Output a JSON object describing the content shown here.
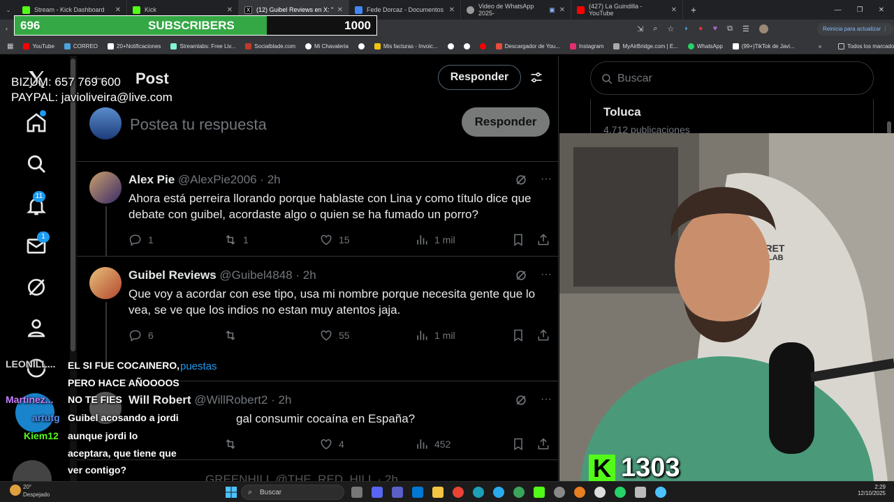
{
  "browser": {
    "tabs": [
      {
        "title": "Stream - Kick Dashboard",
        "color": "#53fc18"
      },
      {
        "title": "Kick",
        "color": "#53fc18"
      },
      {
        "title": "(12) Guibel Reviews en X: \"No e",
        "color": "#000000",
        "active": true
      },
      {
        "title": "Fede Dorcaz - Documentos de",
        "color": "#4285f4"
      },
      {
        "title": "Video de WhatsApp 2025-",
        "color": "#999999"
      },
      {
        "title": "(427) La Guindilla - YouTube",
        "color": "#ff0000"
      }
    ],
    "update_label": "Reinicia para actualizar",
    "bookmarks": [
      {
        "label": "YouTube",
        "color": "#ff0000"
      },
      {
        "label": "CORREO",
        "color": "#4aa3df"
      },
      {
        "label": "20+Notificaciones",
        "color": "#ffffff"
      },
      {
        "label": "Streamlabs: Free Liv...",
        "color": "#80f5d2"
      },
      {
        "label": "Socialblade.com",
        "color": "#c0392b"
      },
      {
        "label": "Mi Chavaleria",
        "color": "#ffffff"
      },
      {
        "label": "",
        "color": "#ffffff"
      },
      {
        "label": "Mis facturas - Invoic...",
        "color": "#f1c40f"
      },
      {
        "label": "",
        "color": "#ffffff"
      },
      {
        "label": "",
        "color": "#ffffff"
      },
      {
        "label": "",
        "color": "#ff0000"
      },
      {
        "label": "Descargador de You...",
        "color": "#e74c3c"
      },
      {
        "label": "Instagram",
        "color": "#e1306c"
      },
      {
        "label": "MyAirBridge.com | E...",
        "color": "#aaaaaa"
      },
      {
        "label": "WhatsApp",
        "color": "#25d366"
      },
      {
        "label": "(99+)TikTok de Javi...",
        "color": "#ffffff"
      }
    ],
    "all_bookmarks": "Todos los marcadores"
  },
  "overlay": {
    "subs_current": "696",
    "subs_label": "SUBSCRIBERS",
    "subs_goal": "1000",
    "subs_progress": 0.696,
    "bizum": "BIZUM: 657 769 600",
    "paypal": "PAYPAL: javioliveira@live.com",
    "kick_logo": "K",
    "kick_viewers": "1303"
  },
  "nav": {
    "notifications_badge": "11",
    "messages_badge": "1"
  },
  "header": {
    "title": "Post",
    "reply_button": "Responder"
  },
  "compose": {
    "placeholder": "Postea tu respuesta",
    "reply_button": "Responder"
  },
  "tweets": [
    {
      "name": "Alex Pie",
      "handle": "@AlexPie2006",
      "time": "· 2h",
      "text": "Ahora está perreira llorando porque hablaste con Lina y como título dice que debate con guibel,  acordaste algo o quien se ha fumado un porro?",
      "replies": "1",
      "reposts": "1",
      "likes": "15",
      "views": "1 mil"
    },
    {
      "name": "Guibel Reviews",
      "handle": "@Guibel4848",
      "time": "· 2h",
      "text": "Que voy a acordar con ese tipo, usa mi nombre porque necesita gente que lo vea, se ve que los indios no estan muy atentos jaja.",
      "replies": "6",
      "reposts": "",
      "likes": "55",
      "views": "1 mil"
    },
    {
      "name": "Will Robert",
      "handle": "@WillRobert2",
      "time": "· 2h",
      "text": "gal consumir cocaína en España?",
      "replies": "",
      "reposts": "",
      "likes": "4",
      "views": "452"
    }
  ],
  "show_replies": "puestas",
  "next_tweet_partial": "GREENHILL @THE_RED_HILL · 2h",
  "sidebar": {
    "search_placeholder": "Buscar",
    "trend_name": "Toluca",
    "trend_count": "4.712 publicaciones"
  },
  "chat": [
    {
      "user": "LEONILL...",
      "color": "#d6d6d6",
      "lines": [
        "EL SI FUE COCAINERO,",
        "PERO HACE AÑOOOOS"
      ]
    },
    {
      "user": "Martinez...",
      "color": "#c77dff",
      "lines": [
        "NO TE FIES"
      ]
    },
    {
      "user": "artutg",
      "color": "#5b8def",
      "lines": [
        "Guibel acosando a jordi"
      ]
    },
    {
      "user": "Kiem12",
      "color": "#53fc18",
      "lines": [
        "aunque jordi lo",
        "aceptara, que tiene que",
        "ver contigo?"
      ]
    },
    {
      "user": "artutg",
      "color": "#5b8def",
      "lines": [
        "Guibel acosando a jordi"
      ]
    }
  ],
  "taskbar": {
    "weather_temp": "20°",
    "weather_label": "Despejado",
    "search_label": "Buscar",
    "time": "2:29",
    "date": "12/10/2025"
  }
}
